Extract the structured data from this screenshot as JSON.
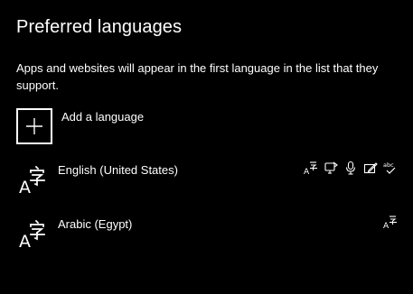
{
  "header": {
    "title": "Preferred languages"
  },
  "description": "Apps and websites will appear in the first language in the list that they support.",
  "add_language": {
    "icon": "plus-icon",
    "label": "Add a language"
  },
  "languages": [
    {
      "name": "English (United States)",
      "icon": "language-icon",
      "features": [
        "display-language-icon",
        "text-to-speech-icon",
        "speech-recognition-icon",
        "handwriting-icon",
        "spell-check-icon"
      ]
    },
    {
      "name": "Arabic (Egypt)",
      "icon": "language-icon",
      "features": [
        "display-language-icon"
      ]
    }
  ],
  "colors": {
    "background": "#000000",
    "foreground": "#ffffff"
  }
}
